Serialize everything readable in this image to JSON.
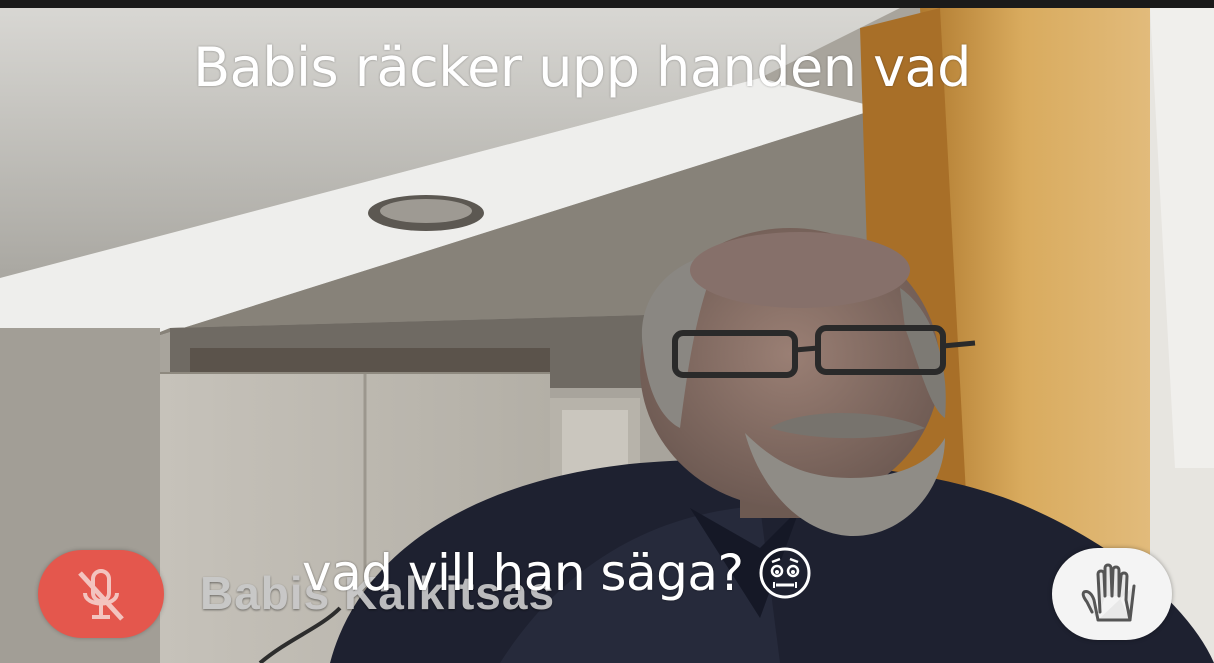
{
  "captions": {
    "top": "Babis räcker upp handen vad",
    "bottom": "vad vill han säga?"
  },
  "participant": {
    "name": "Babis Kalkitsas",
    "mic_status": "muted",
    "hand_status": "raised"
  },
  "icons": {
    "mic": "mic-off-icon",
    "hand": "raised-hand-icon",
    "emoji": "worried-face-icon"
  },
  "colors": {
    "mic_button": "#e4574d",
    "hand_button": "#f4f4f4",
    "caption_text": "#ffffff"
  }
}
